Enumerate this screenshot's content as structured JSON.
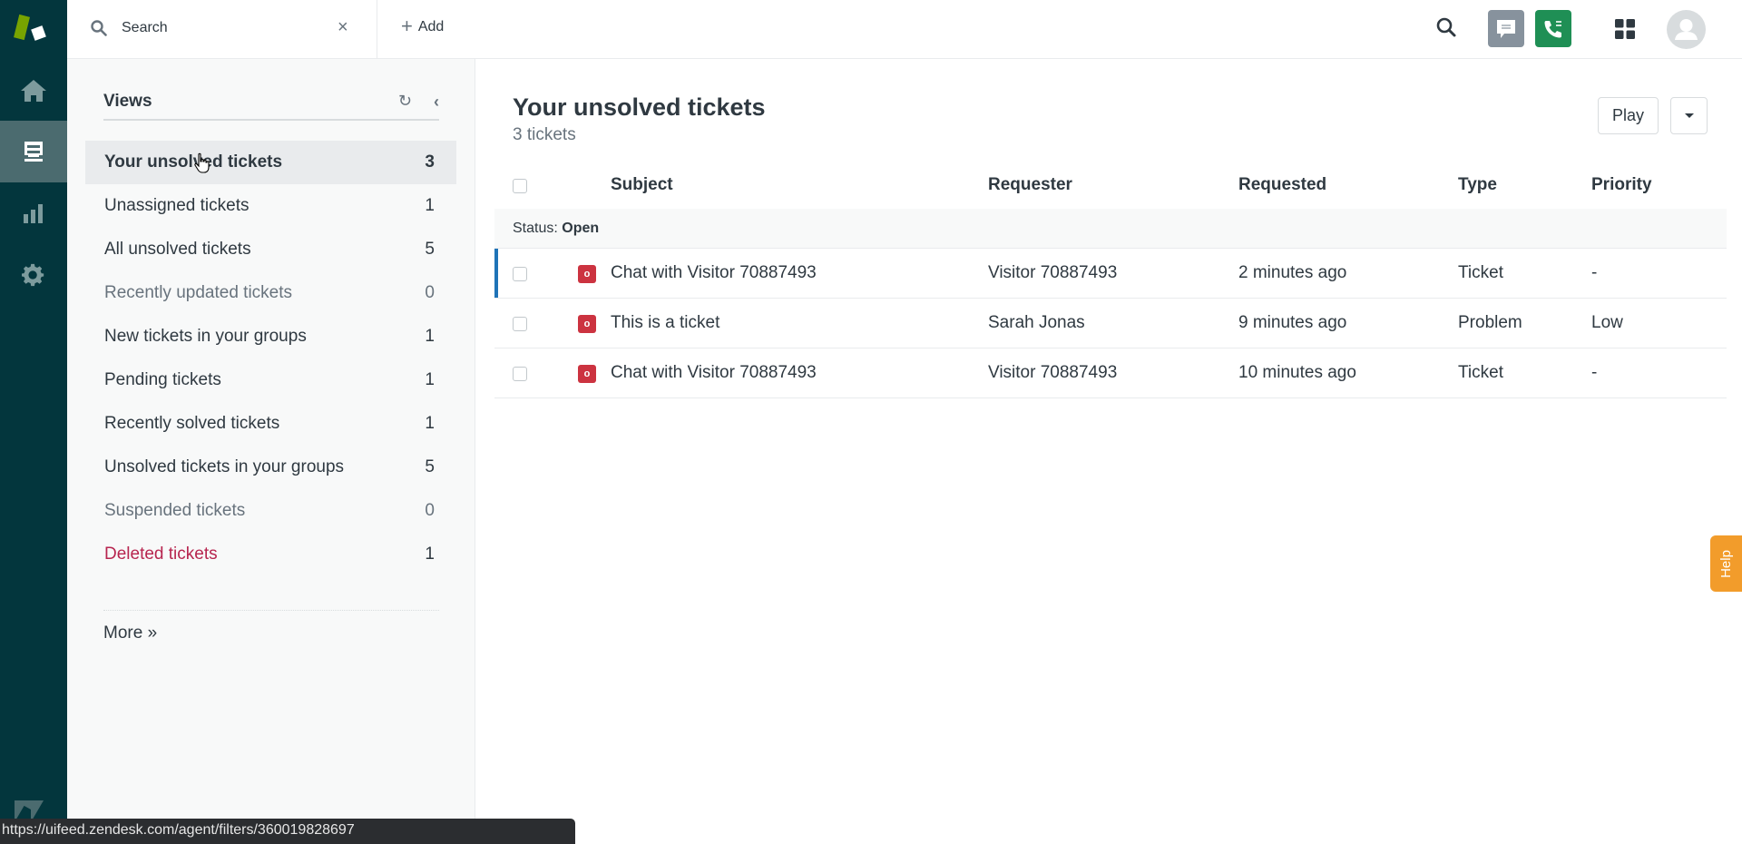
{
  "nav": {
    "items": [
      {
        "name": "home",
        "icon": "home-icon",
        "active": false
      },
      {
        "name": "views",
        "icon": "inbox-icon",
        "active": true
      },
      {
        "name": "reporting",
        "icon": "bar-chart-icon",
        "active": false
      },
      {
        "name": "admin",
        "icon": "gear-icon",
        "active": false
      }
    ]
  },
  "topbar": {
    "search_text": "Search",
    "clear_glyph": "×",
    "add_label": "Add",
    "add_glyph": "+"
  },
  "views": {
    "title": "Views",
    "refresh_glyph": "↻",
    "collapse_glyph": "‹",
    "items": [
      {
        "label": "Your unsolved tickets",
        "count": "3",
        "state": "active"
      },
      {
        "label": "Unassigned tickets",
        "count": "1",
        "state": "normal"
      },
      {
        "label": "All unsolved tickets",
        "count": "5",
        "state": "normal"
      },
      {
        "label": "Recently updated tickets",
        "count": "0",
        "state": "muted"
      },
      {
        "label": "New tickets in your groups",
        "count": "1",
        "state": "normal"
      },
      {
        "label": "Pending tickets",
        "count": "1",
        "state": "normal"
      },
      {
        "label": "Recently solved tickets",
        "count": "1",
        "state": "normal"
      },
      {
        "label": "Unsolved tickets in your groups",
        "count": "5",
        "state": "normal"
      },
      {
        "label": "Suspended tickets",
        "count": "0",
        "state": "muted"
      },
      {
        "label": "Deleted tickets",
        "count": "1",
        "state": "danger"
      }
    ],
    "more_label": "More »"
  },
  "main": {
    "title": "Your unsolved tickets",
    "subtitle": "3 tickets",
    "play_label": "Play",
    "columns": {
      "subject": "Subject",
      "requester": "Requester",
      "requested": "Requested",
      "type": "Type",
      "priority": "Priority"
    },
    "group": {
      "label": "Status:",
      "value": "Open"
    },
    "rows": [
      {
        "status_badge": "o",
        "subject": "Chat with Visitor 70887493",
        "requester": "Visitor 70887493",
        "requested": "2 minutes ago",
        "type": "Ticket",
        "priority": "-",
        "selected": true
      },
      {
        "status_badge": "o",
        "subject": "This is a ticket",
        "requester": "Sarah Jonas",
        "requested": "9 minutes ago",
        "type": "Problem",
        "priority": "Low",
        "selected": false
      },
      {
        "status_badge": "o",
        "subject": "Chat with Visitor 70887493",
        "requester": "Visitor 70887493",
        "requested": "10 minutes ago",
        "type": "Ticket",
        "priority": "-",
        "selected": false
      }
    ]
  },
  "help_label": "Help",
  "status_url": "https://uifeed.zendesk.com/agent/filters/360019828697",
  "colors": {
    "nav_bg": "#03363d",
    "brand_green": "#78a300",
    "phone_green": "#1f8f55",
    "status_open": "#cc3340",
    "selected_bar": "#1f73b7",
    "danger": "#b7254f",
    "help": "#f29c2b"
  }
}
